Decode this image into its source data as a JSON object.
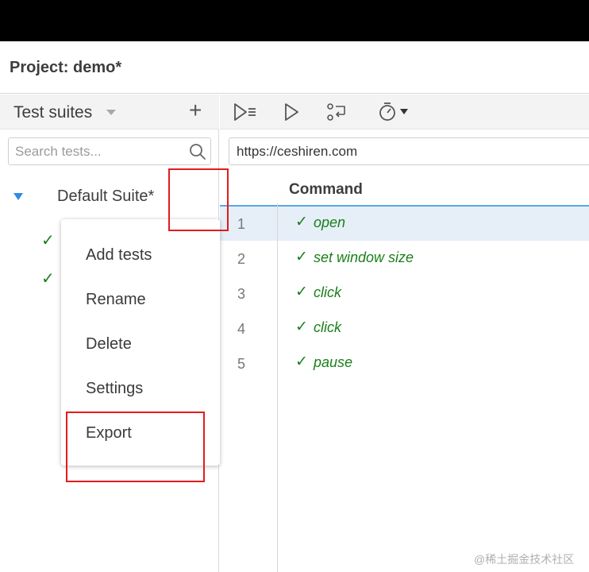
{
  "project": {
    "label": "Project:  demo*"
  },
  "sidebar": {
    "title": "Test suites",
    "add_icon": "plus-icon",
    "search": {
      "placeholder": "Search tests...",
      "value": ""
    },
    "suite": {
      "name": "Default Suite*",
      "expanded": true,
      "test_count": 2
    }
  },
  "context_menu": {
    "items": [
      "Add tests",
      "Rename",
      "Delete",
      "Settings",
      "Export"
    ]
  },
  "toolbar": {
    "icons": [
      "run-all-icon",
      "run-icon",
      "record-icon",
      "speed-icon"
    ]
  },
  "url": {
    "value": "https://ceshiren.com"
  },
  "table": {
    "column_header": "Command",
    "rows": [
      {
        "num": "1",
        "command": "open",
        "status": "passed",
        "selected": true
      },
      {
        "num": "2",
        "command": "set window size",
        "status": "passed",
        "selected": false
      },
      {
        "num": "3",
        "command": "click",
        "status": "passed",
        "selected": false
      },
      {
        "num": "4",
        "command": "click",
        "status": "passed",
        "selected": false
      },
      {
        "num": "5",
        "command": "pause",
        "status": "passed",
        "selected": false
      }
    ]
  },
  "check_glyph": "✓",
  "watermark": "@稀土掘金技术社区",
  "colors": {
    "pass": "#1a7f1a",
    "accent": "#2f8be6",
    "annotation": "#e41b1b",
    "selected_row": "#e6eff8"
  }
}
